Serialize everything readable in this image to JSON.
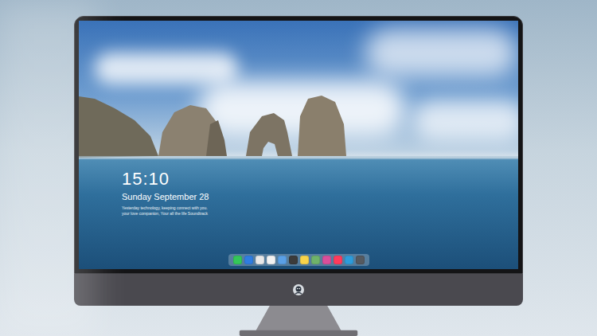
{
  "lock_screen": {
    "time": "15:10",
    "date": "Sunday September 28",
    "tagline": [
      "Yesterday technology, keeping connect with you.",
      "your love companion, Your all the life Soundtrack"
    ]
  },
  "dock": {
    "items": [
      {
        "color": "#34c759"
      },
      {
        "color": "#2f7de1"
      },
      {
        "color": "#e8e8e8"
      },
      {
        "color": "#f2f2f2"
      },
      {
        "color": "#5aa0e6"
      },
      {
        "color": "#3b3b3b"
      },
      {
        "color": "#f7d34a"
      },
      {
        "color": "#6fb36a"
      },
      {
        "color": "#d94f9a"
      },
      {
        "color": "#ff3b5c"
      },
      {
        "color": "#2d9cdb"
      },
      {
        "color": "#555a60"
      }
    ]
  }
}
